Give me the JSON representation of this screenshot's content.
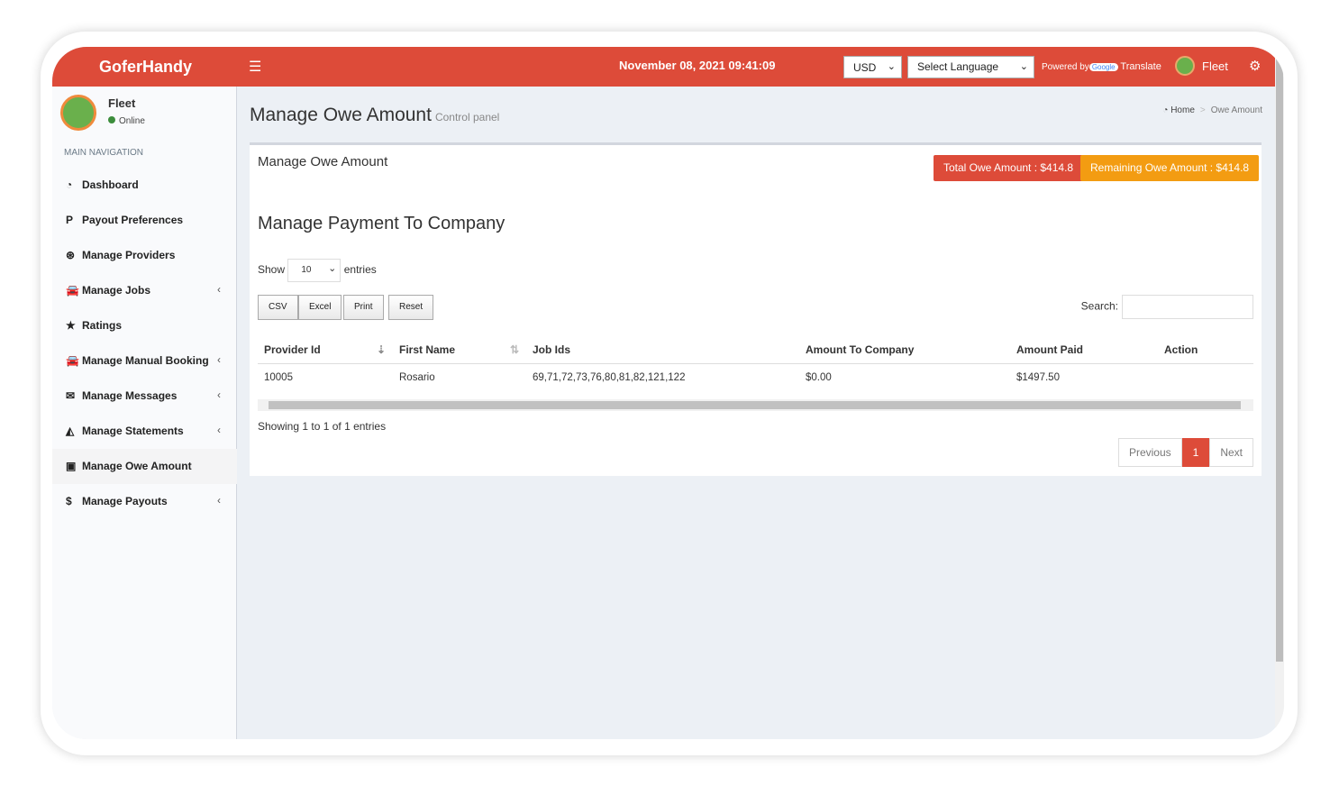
{
  "header": {
    "logo": "GoferHandy",
    "datetime": "November 08, 2021 09:41:09",
    "currency": "USD",
    "language": "Select Language",
    "powered_by": "Powered by",
    "google": "Google",
    "translate": "Translate",
    "user": "Fleet"
  },
  "sidebar": {
    "user": "Fleet",
    "status": "Online",
    "nav_header": "MAIN NAVIGATION",
    "items": [
      {
        "label": "Dashboard",
        "icon": "dashboard"
      },
      {
        "label": "Payout Preferences",
        "icon": "paypal"
      },
      {
        "label": "Manage Providers",
        "icon": "support"
      },
      {
        "label": "Manage Jobs",
        "icon": "car"
      },
      {
        "label": "Ratings",
        "icon": "star"
      },
      {
        "label": "Manage Manual Booking",
        "icon": "car"
      },
      {
        "label": "Manage Messages",
        "icon": "envelope"
      },
      {
        "label": "Manage Statements",
        "icon": "area-chart"
      },
      {
        "label": "Manage Owe Amount",
        "icon": "money"
      },
      {
        "label": "Manage Payouts",
        "icon": "dollar"
      }
    ]
  },
  "page": {
    "title": "Manage Owe Amount",
    "subtitle": "Control panel",
    "breadcrumb": [
      "Home",
      "Owe Amount"
    ]
  },
  "box": {
    "title": "Manage Owe Amount",
    "total": "Total Owe Amount : $414.8",
    "remaining": "Remaining Owe Amount : $414.8",
    "heading": "Manage Payment To Company",
    "show": "Show",
    "entries_value": "10",
    "entries": "entries",
    "buttons": [
      "CSV",
      "Excel",
      "Print",
      "Reset"
    ],
    "search_label": "Search:",
    "columns": [
      "Provider Id",
      "First Name",
      "Job Ids",
      "Amount To Company",
      "Amount Paid",
      "Action"
    ],
    "rows": [
      [
        "10005",
        "Rosario",
        "69,71,72,73,76,80,81,82,121,122",
        "$0.00",
        "$1497.50",
        ""
      ]
    ],
    "info": "Showing 1 to 1 of 1 entries",
    "prev": "Previous",
    "page": "1",
    "next": "Next"
  },
  "colors": {
    "brand": "#dd4b39",
    "warning": "#f39c12"
  }
}
